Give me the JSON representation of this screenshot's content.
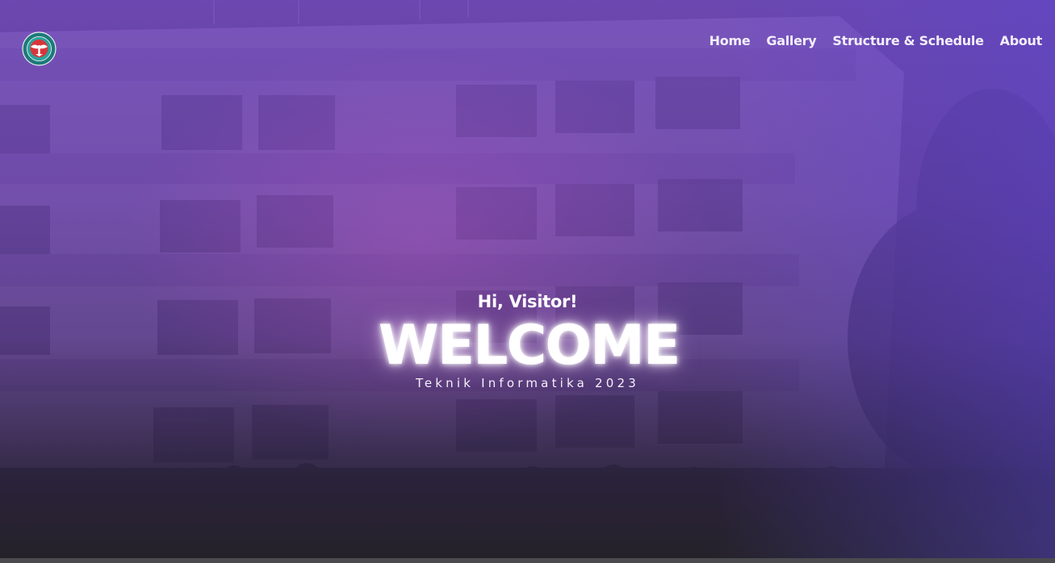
{
  "site": {
    "logo_icon": "university-crest-icon"
  },
  "nav": {
    "items": [
      {
        "label": "Home"
      },
      {
        "label": "Gallery"
      },
      {
        "label": "Structure & Schedule"
      },
      {
        "label": "About"
      }
    ]
  },
  "hero": {
    "greeting": "Hi, Visitor!",
    "headline": "WELCOME",
    "subtitle": "Teknik Informatika 2023",
    "accent_color": "#8a55e0",
    "background_image": "building-facade-photo"
  }
}
